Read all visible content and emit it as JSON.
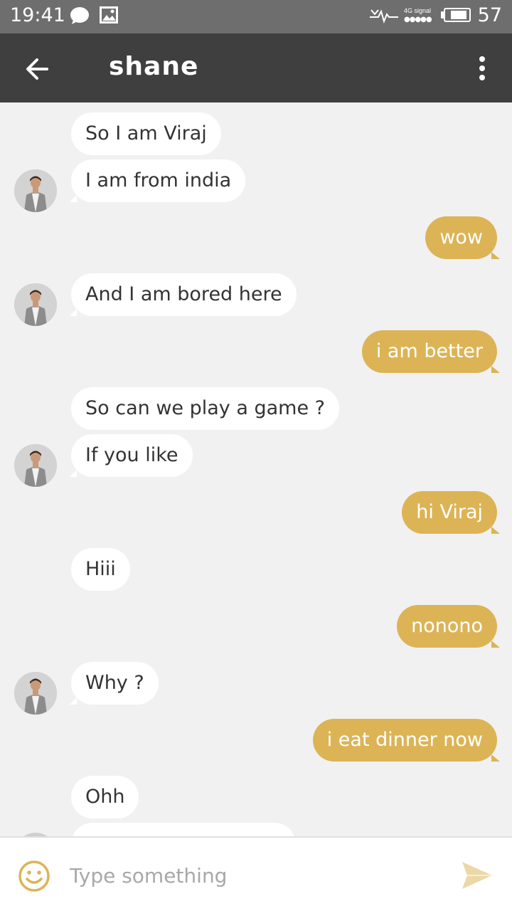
{
  "status_bar": {
    "time": "19:41",
    "network": "4G signal",
    "battery": "57"
  },
  "header": {
    "title": "shane"
  },
  "messages": [
    {
      "dir": "in",
      "text": "So I am Viraj"
    },
    {
      "dir": "in",
      "text": "I am from india"
    },
    {
      "dir": "out",
      "text": "wow"
    },
    {
      "dir": "in",
      "text": "And I am bored here"
    },
    {
      "dir": "out",
      "text": "i am better"
    },
    {
      "dir": "in",
      "text": "So can we play a game ?"
    },
    {
      "dir": "in",
      "text": "If you like"
    },
    {
      "dir": "out",
      "text": "hi Viraj"
    },
    {
      "dir": "in",
      "text": "Hiii"
    },
    {
      "dir": "out",
      "text": "nonono"
    },
    {
      "dir": "in",
      "text": "Why ?"
    },
    {
      "dir": "out",
      "text": "i eat dinner now"
    },
    {
      "dir": "in",
      "text": "Ohh"
    }
  ],
  "composer": {
    "placeholder": "Type something"
  },
  "colors": {
    "outgoing_bubble": "#dcb456",
    "header_bg": "#3f3f3f",
    "status_bg": "#6e6e6e"
  }
}
